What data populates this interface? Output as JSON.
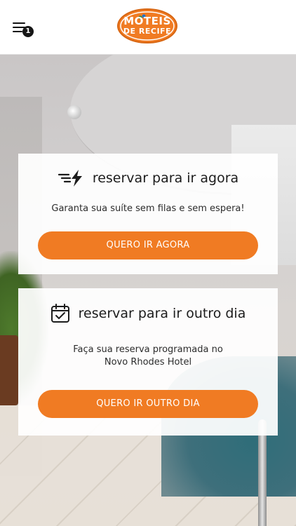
{
  "header": {
    "menu_badge": "1",
    "logo": {
      "line1": "MOTEIS",
      "line2": "DE RECIFE",
      "color": "#f07b23"
    }
  },
  "cards": {
    "now": {
      "icon": "fast-lightning-icon",
      "title": "reservar para ir agora",
      "text": "Garanta sua suíte sem filas e sem espera!",
      "button": "QUERO IR AGORA"
    },
    "other": {
      "icon": "calendar-check-icon",
      "title": "reservar para ir outro dia",
      "text_line1": "Faça sua reserva programada no",
      "text_line2": "Novo Rhodes Hotel",
      "button": "QUERO IR OUTRO DIA"
    }
  },
  "colors": {
    "accent": "#f07b23",
    "text": "#1c1c1c"
  }
}
